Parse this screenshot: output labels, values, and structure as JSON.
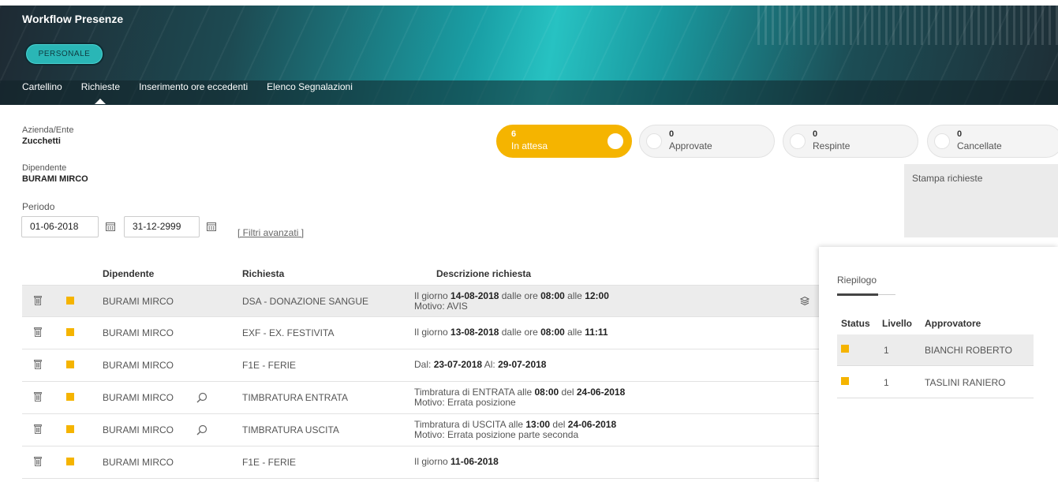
{
  "header": {
    "title": "Workflow Presenze",
    "profile_pill": "PERSONALE",
    "nav": [
      "Cartellino",
      "Richieste",
      "Inserimento ore eccedenti",
      "Elenco Segnalazioni"
    ],
    "active_nav": "Richieste"
  },
  "filters": {
    "azienda_label": "Azienda/Ente",
    "azienda_value": "Zucchetti",
    "dipendente_label": "Dipendente",
    "dipendente_value": "BURAMI MIRCO",
    "periodo_label": "Periodo",
    "date_from": "01-06-2018",
    "date_to": "31-12-2999",
    "advanced_link": "[ Filtri avanzati ]"
  },
  "status_toggles": [
    {
      "count": "6",
      "label": "In attesa",
      "active": true
    },
    {
      "count": "0",
      "label": "Approvate",
      "active": false
    },
    {
      "count": "0",
      "label": "Respinte",
      "active": false
    },
    {
      "count": "0",
      "label": "Cancellate",
      "active": false
    }
  ],
  "print_label": "Stampa richieste",
  "table": {
    "headers": {
      "dipendente": "Dipendente",
      "richiesta": "Richiesta",
      "descrizione": "Descrizione richiesta"
    },
    "rows": [
      {
        "dipendente": "BURAMI MIRCO",
        "richiesta": "DSA - DONAZIONE SANGUE",
        "has_search": false,
        "d1": [
          "Il giorno ",
          "14-08-2018",
          " dalle ore ",
          "08:00",
          " alle ",
          "12:00"
        ],
        "d2": "Motivo: AVIS"
      },
      {
        "dipendente": "BURAMI MIRCO",
        "richiesta": "EXF - EX. FESTIVITA",
        "has_search": false,
        "d1": [
          "Il giorno ",
          "13-08-2018",
          " dalle ore ",
          "08:00",
          " alle ",
          "11:11"
        ],
        "d2": ""
      },
      {
        "dipendente": "BURAMI MIRCO",
        "richiesta": "F1E - FERIE",
        "has_search": false,
        "d1": [
          "Dal: ",
          "23-07-2018",
          " Al: ",
          "29-07-2018"
        ],
        "d2": ""
      },
      {
        "dipendente": "BURAMI MIRCO",
        "richiesta": "TIMBRATURA ENTRATA",
        "has_search": true,
        "d1": [
          "Timbratura di ENTRATA alle ",
          "08:00",
          " del ",
          "24-06-2018"
        ],
        "d2": "Motivo: Errata posizione"
      },
      {
        "dipendente": "BURAMI MIRCO",
        "richiesta": "TIMBRATURA USCITA",
        "has_search": true,
        "d1": [
          "Timbratura di USCITA alle ",
          "13:00",
          " del ",
          "24-06-2018"
        ],
        "d2": "Motivo: Errata posizione parte seconda"
      },
      {
        "dipendente": "BURAMI MIRCO",
        "richiesta": "F1E - FERIE",
        "has_search": false,
        "d1": [
          "Il giorno ",
          "11-06-2018"
        ],
        "d2": ""
      }
    ]
  },
  "riepilogo": {
    "title": "Riepilogo",
    "headers": {
      "status": "Status",
      "livello": "Livello",
      "approvatore": "Approvatore"
    },
    "rows": [
      {
        "livello": "1",
        "approvatore": "BIANCHI ROBERTO"
      },
      {
        "livello": "1",
        "approvatore": "TASLINI RANIERO"
      }
    ]
  },
  "colors": {
    "accent": "#f5b400",
    "header_teal": "#1aa0a6"
  }
}
